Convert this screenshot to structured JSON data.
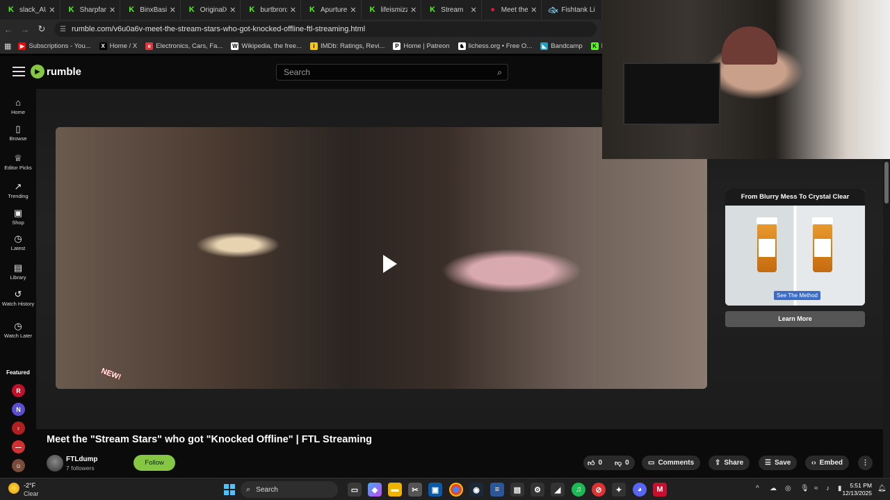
{
  "browser": {
    "tabs": [
      {
        "label": "slack_AU",
        "icon": "kick-icon"
      },
      {
        "label": "Sharpfart -",
        "icon": "kick-icon"
      },
      {
        "label": "BinxBasilis",
        "icon": "kick-icon"
      },
      {
        "label": "OriginalXU",
        "icon": "kick-icon"
      },
      {
        "label": "burtbronx",
        "icon": "kick-icon"
      },
      {
        "label": "Apurture S",
        "icon": "kick-icon"
      },
      {
        "label": "lifeismizzy",
        "icon": "kick-icon"
      },
      {
        "label": "Stream",
        "icon": "kick-icon"
      },
      {
        "label": "Meet the \"",
        "icon": "rumble-icon"
      },
      {
        "label": "Fishtank Li",
        "icon": "fishtank-icon"
      }
    ],
    "url": "rumble.com/v6u0a6v-meet-the-stream-stars-who-got-knocked-offline-ftl-streaming.html",
    "bookmarks": [
      {
        "label": "Subscriptions - You...",
        "color": "#ff0000",
        "glyph": "▶"
      },
      {
        "label": "Home / X",
        "color": "#000000",
        "glyph": "X"
      },
      {
        "label": "Electronics, Cars, Fa...",
        "color": "#e53238",
        "glyph": "e"
      },
      {
        "label": "Wikipedia, the free...",
        "color": "#ffffff",
        "glyph": "W"
      },
      {
        "label": "IMDb: Ratings, Revi...",
        "color": "#f5c518",
        "glyph": "i"
      },
      {
        "label": "Home | Patreon",
        "color": "#ffffff",
        "glyph": "P"
      },
      {
        "label": "lichess.org • Free O...",
        "color": "#ffffff",
        "glyph": "♞"
      },
      {
        "label": "Bandcamp",
        "color": "#1da0c3",
        "glyph": "◣"
      },
      {
        "label": "Kick",
        "color": "#53fc18",
        "glyph": "K"
      }
    ]
  },
  "header": {
    "logo_text": "rumble",
    "search_placeholder": "Search"
  },
  "sidebar": {
    "items": [
      {
        "label": "Home",
        "icon": "home-icon",
        "glyph": "⌂"
      },
      {
        "label": "Browse",
        "icon": "browse-icon",
        "glyph": "▯"
      },
      {
        "label": "Editor Picks",
        "icon": "editor-picks-icon",
        "glyph": "♕"
      },
      {
        "label": "Trending",
        "icon": "trending-icon",
        "glyph": "↗"
      },
      {
        "label": "Shop",
        "icon": "shop-icon",
        "glyph": "▣"
      },
      {
        "label": "Latest",
        "icon": "clock-icon",
        "glyph": "◷"
      },
      {
        "label": "Library",
        "icon": "library-icon",
        "glyph": "▤"
      },
      {
        "label": "Watch History",
        "icon": "history-icon",
        "glyph": "↺"
      },
      {
        "label": "Watch Later",
        "icon": "watch-later-icon",
        "glyph": "◷"
      }
    ],
    "featured_label": "Featured",
    "featured_channels": [
      {
        "glyph": "R",
        "color": "#c0102a"
      },
      {
        "glyph": "N",
        "color": "#5a4ed0"
      },
      {
        "glyph": "♀",
        "color": "#b02020"
      },
      {
        "glyph": "—",
        "color": "#d03030"
      },
      {
        "glyph": "☺",
        "color": "#7a4a3a"
      }
    ]
  },
  "video": {
    "badge_text": "NEW!",
    "title": "Meet the \"Stream Stars\" who got \"Knocked Offline\" | FTL Streaming",
    "channel_name": "FTLdump",
    "followers": "7 followers",
    "follow_label": "Follow",
    "likes": "0",
    "dislikes": "0",
    "comments_label": "Comments",
    "share_label": "Share",
    "save_label": "Save",
    "embed_label": "Embed"
  },
  "ad": {
    "headline": "From Blurry Mess To Crystal Clear",
    "overlay_label": "See The Method",
    "cta": "Learn More"
  },
  "taskbar": {
    "weather_temp": "-2°F",
    "weather_condition": "Clear",
    "search_label": "Search",
    "time": "5:51 PM",
    "date": "12/13/2025"
  }
}
